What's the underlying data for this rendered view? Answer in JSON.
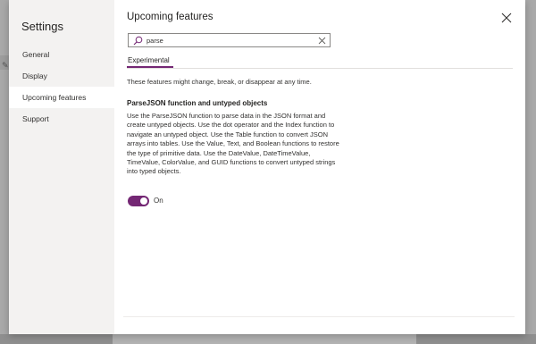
{
  "settings": {
    "title": "Settings",
    "nav_items": [
      {
        "label": "General"
      },
      {
        "label": "Display"
      },
      {
        "label": "Upcoming features"
      },
      {
        "label": "Support"
      }
    ],
    "active_item": "Upcoming features"
  },
  "panel": {
    "title": "Upcoming features",
    "search": {
      "value": "parse",
      "placeholder": ""
    },
    "tabs": [
      {
        "label": "Experimental"
      }
    ],
    "disclaimer": "These features might change, break, or disappear at any time.",
    "feature": {
      "title": "ParseJSON function and untyped objects",
      "description": "Use the ParseJSON function to parse data in the JSON format and create untyped objects. Use the dot operator and the Index function to navigate an untyped object. Use the Table function to convert JSON arrays into tables. Use the Value, Text, and Boolean functions to restore the type of primitive data. Use the DateValue, DateTimeValue, TimeValue, ColorValue, and GUID functions to convert untyped strings into typed objects.",
      "toggle_state": "On"
    }
  },
  "colors": {
    "accent": "#742774",
    "nav_background": "#f3f2f1",
    "overlay": "#a9a9a9"
  }
}
